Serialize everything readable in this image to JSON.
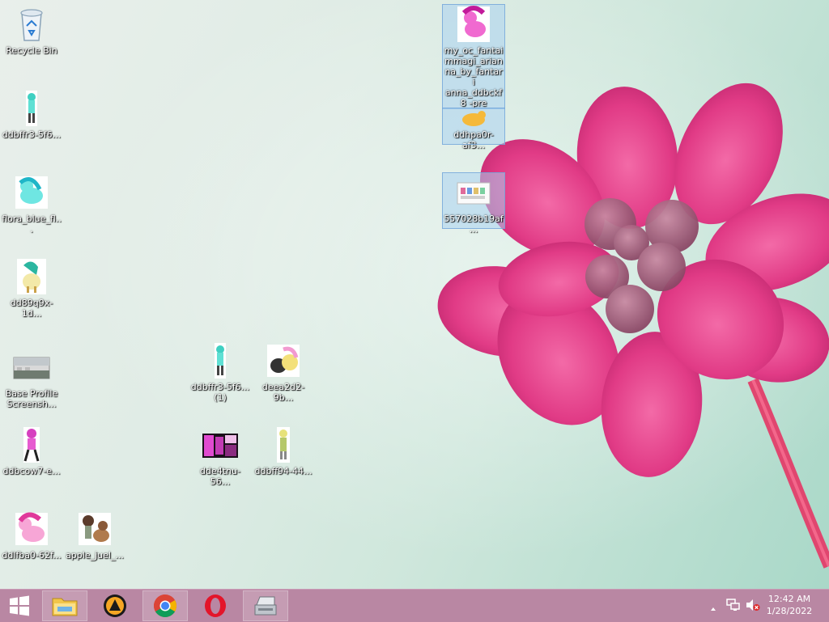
{
  "desktop": {
    "icons": [
      {
        "label": "Recycle Bin",
        "thumb": "recycle-bin-icon"
      },
      {
        "label": "ddbffr3-5f6...",
        "thumb": "pony-image-thumbnail"
      },
      {
        "label": "flora_blue_fl...",
        "thumb": "pony-image-thumbnail"
      },
      {
        "label": "dd89q9x-1d...",
        "thumb": "pony-image-thumbnail"
      },
      {
        "label": "Base Profile Screensh...",
        "thumb": "screenshot-thumbnail"
      },
      {
        "label": "ddbcow7-e...",
        "thumb": "pony-image-thumbnail"
      },
      {
        "label": "ddlfba0-62f...",
        "thumb": "pony-image-thumbnail"
      },
      {
        "label": "apple_juel_...",
        "thumb": "pony-image-thumbnail"
      },
      {
        "label": "ddbffr3-5f6... (1)",
        "thumb": "pony-image-thumbnail"
      },
      {
        "label": "deea2d2-9b...",
        "thumb": "pony-image-thumbnail"
      },
      {
        "label": "dde4tnu-56...",
        "thumb": "screenshot-thumbnail"
      },
      {
        "label": "ddbff94-44...",
        "thumb": "pony-image-thumbnail"
      },
      {
        "label": "my_oc_fantai mmagi_arian na_by_fantari anna_ddbckf8 -pre",
        "thumb": "pony-image-thumbnail"
      },
      {
        "label": "ddhpa0r-af3...",
        "thumb": "pony-image-thumbnail"
      },
      {
        "label": "557028b19af...",
        "thumb": "screenshot-thumbnail"
      }
    ]
  },
  "taskbar": {
    "start": "windows-start-icon",
    "apps": [
      "file-explorer-icon",
      "aimp-player-icon",
      "chrome-icon",
      "opera-icon",
      "scanner-app-icon"
    ],
    "tray": [
      "show-hidden-icons-chevron-icon",
      "network-icon",
      "volume-muted-icon"
    ],
    "time": "12:42 AM",
    "date": "1/28/2022"
  },
  "colors": {
    "taskbar": "#b987a3",
    "flower_pink": "#e23d87",
    "background": "#d6ece2"
  }
}
